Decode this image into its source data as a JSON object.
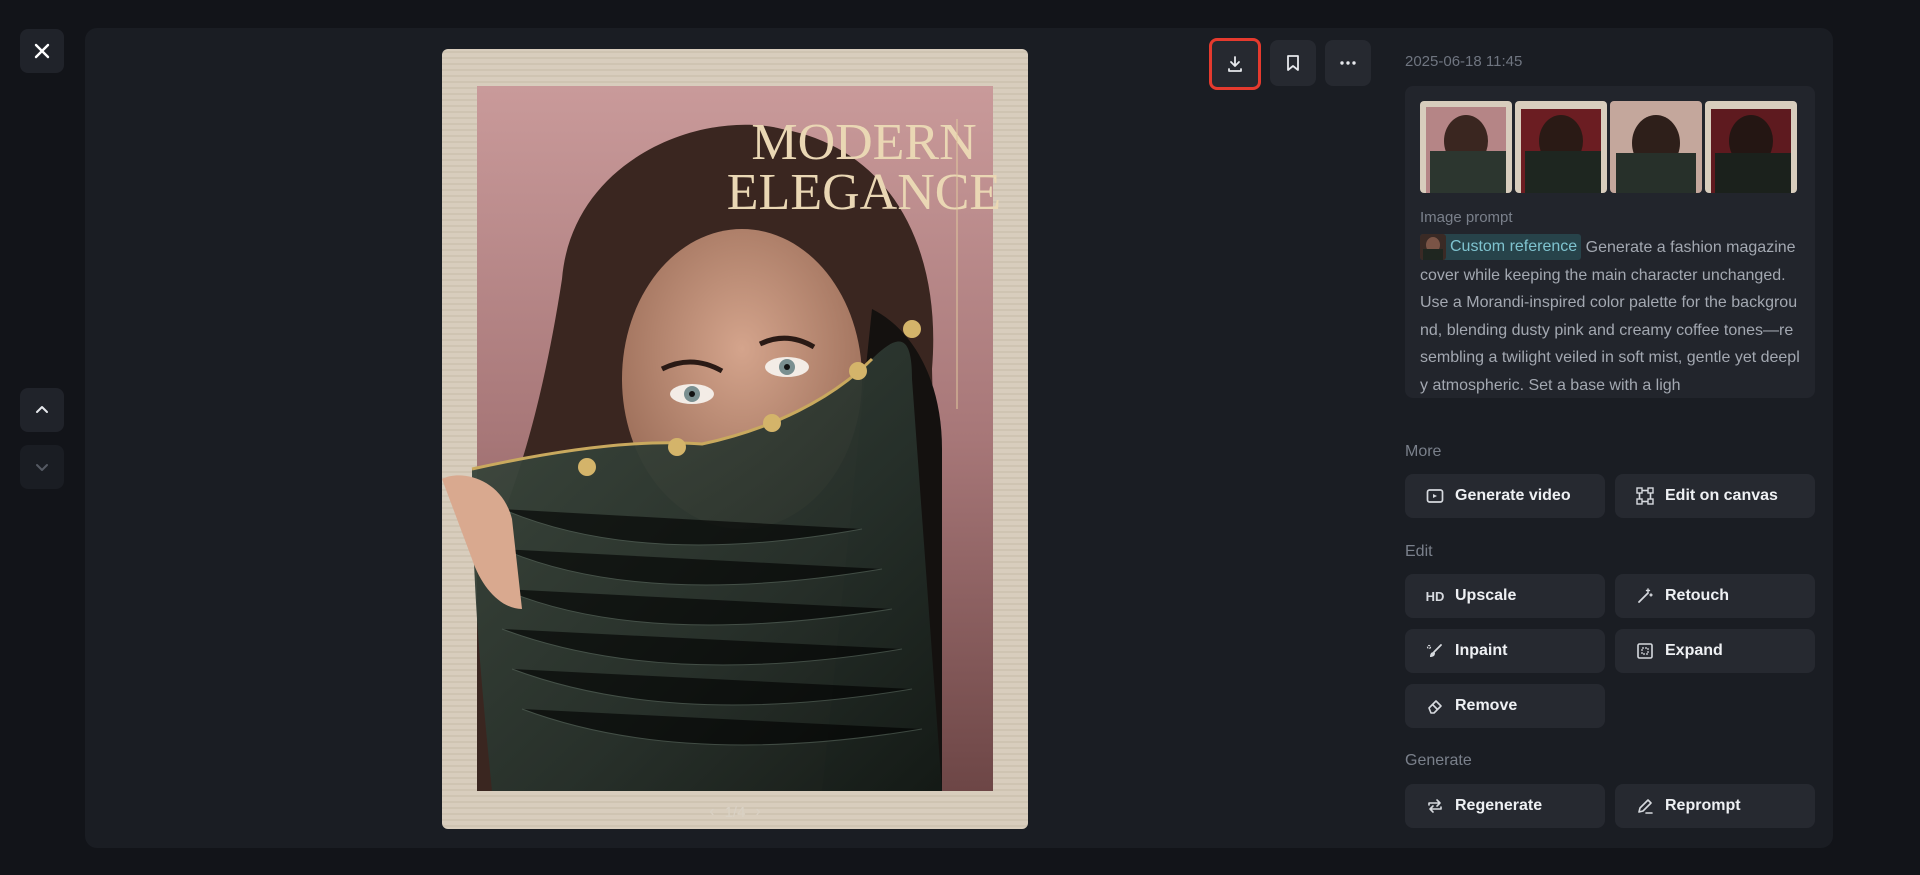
{
  "viewer": {
    "pager_text": "1/4",
    "cover_title_line1": "MODERN",
    "cover_title_line2": "ELEGANCE"
  },
  "toolbar": {
    "download_icon": "download-icon",
    "bookmark_icon": "bookmark-icon",
    "more_icon": "more-horizontal-icon"
  },
  "details": {
    "timestamp": "2025-06-18 11:45",
    "prompt_label": "Image prompt",
    "reference_chip": "Custom reference",
    "prompt_text": "Generate a fashion magazine cover while keeping the main character unchanged. Use a Morandi-inspired color palette for the background, blending dusty pink and creamy coffee tones—resembling a twilight veiled in soft mist, gentle yet deeply atmospheric. Set a base with a ligh"
  },
  "sections": {
    "more": "More",
    "edit": "Edit",
    "generate": "Generate"
  },
  "actions": {
    "generate_video": "Generate video",
    "edit_on_canvas": "Edit on canvas",
    "upscale_badge": "HD",
    "upscale": "Upscale",
    "retouch": "Retouch",
    "inpaint": "Inpaint",
    "expand": "Expand",
    "remove": "Remove",
    "regenerate": "Regenerate",
    "reprompt": "Reprompt"
  },
  "colors": {
    "background": "#121419",
    "panel": "#1a1d23",
    "button": "#262930",
    "highlight_border": "#e53a2e",
    "chip": "#27434a"
  }
}
